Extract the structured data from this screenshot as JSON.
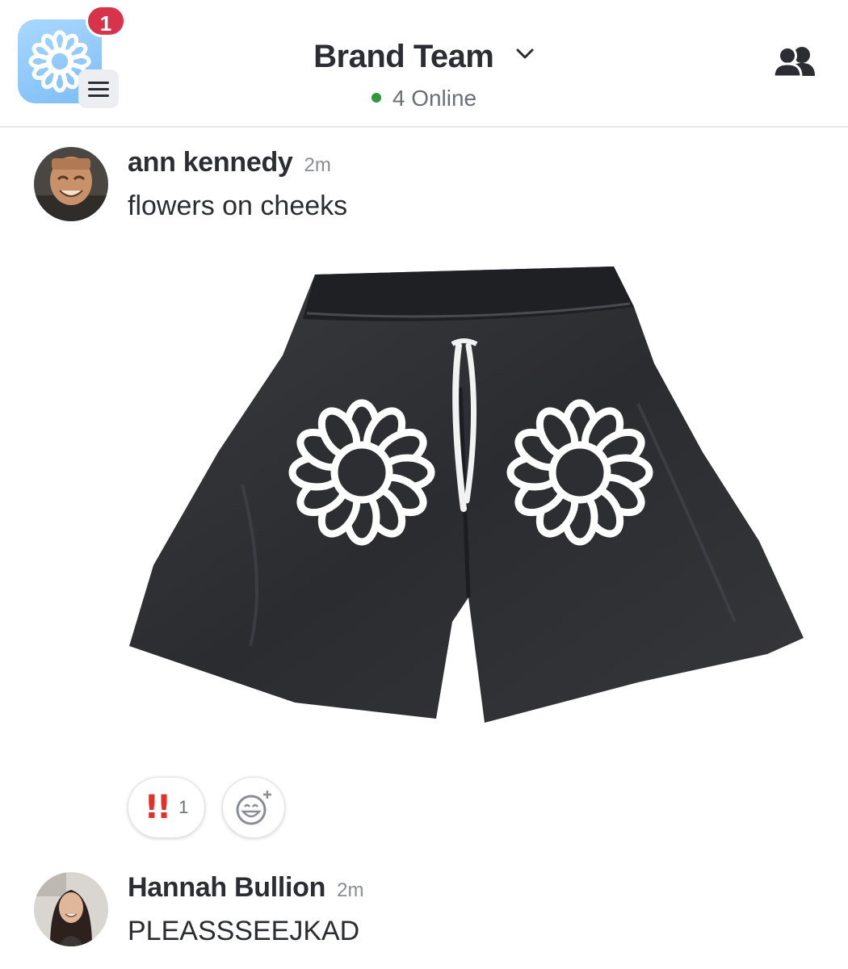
{
  "header": {
    "notification_count": "1",
    "channel_name": "Brand Team",
    "online_status": "4 Online"
  },
  "messages": [
    {
      "author": "ann kennedy",
      "time": "2m",
      "text": "flowers on cheeks",
      "reactions": [
        {
          "emoji": "!!",
          "count": "1"
        }
      ]
    },
    {
      "author": "Hannah Bullion",
      "time": "2m",
      "text": "PLEASSSEEJKAD"
    }
  ],
  "colors": {
    "badge": "#d7334a",
    "online_dot": "#2e9a3c",
    "reaction_bang": "#e0312a",
    "app_icon": "#8cc8fa"
  }
}
